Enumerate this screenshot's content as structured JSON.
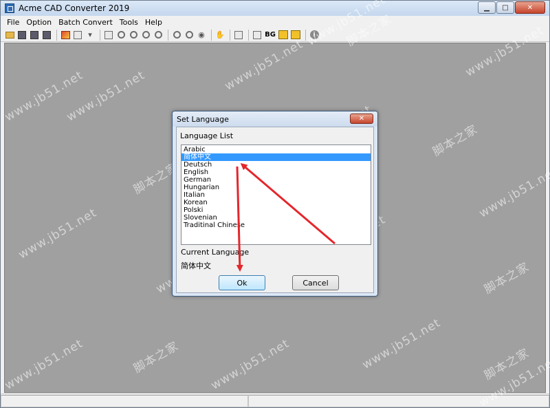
{
  "window": {
    "title": "Acme CAD Converter 2019"
  },
  "menu": [
    "File",
    "Option",
    "Batch Convert",
    "Tools",
    "Help"
  ],
  "toolbar": {
    "bg_label": "BG"
  },
  "dialog": {
    "title": "Set Language",
    "list_label": "Language List",
    "languages": [
      "Arabic",
      "简体中文",
      "Deutsch",
      "English",
      "German",
      "Hungarian",
      "Italian",
      "Korean",
      "Polski",
      "Slovenian",
      "Traditinal Chinese"
    ],
    "selected_index": 1,
    "current_label": "Current Language",
    "current_value": "简体中文",
    "ok_label": "Ok",
    "cancel_label": "Cancel"
  },
  "watermark": {
    "site": "www.jb51.net",
    "cn": "脚本之家"
  },
  "colors": {
    "selection": "#3399ff",
    "canvas": "#a0a0a0",
    "arrow": "#e4262b"
  }
}
